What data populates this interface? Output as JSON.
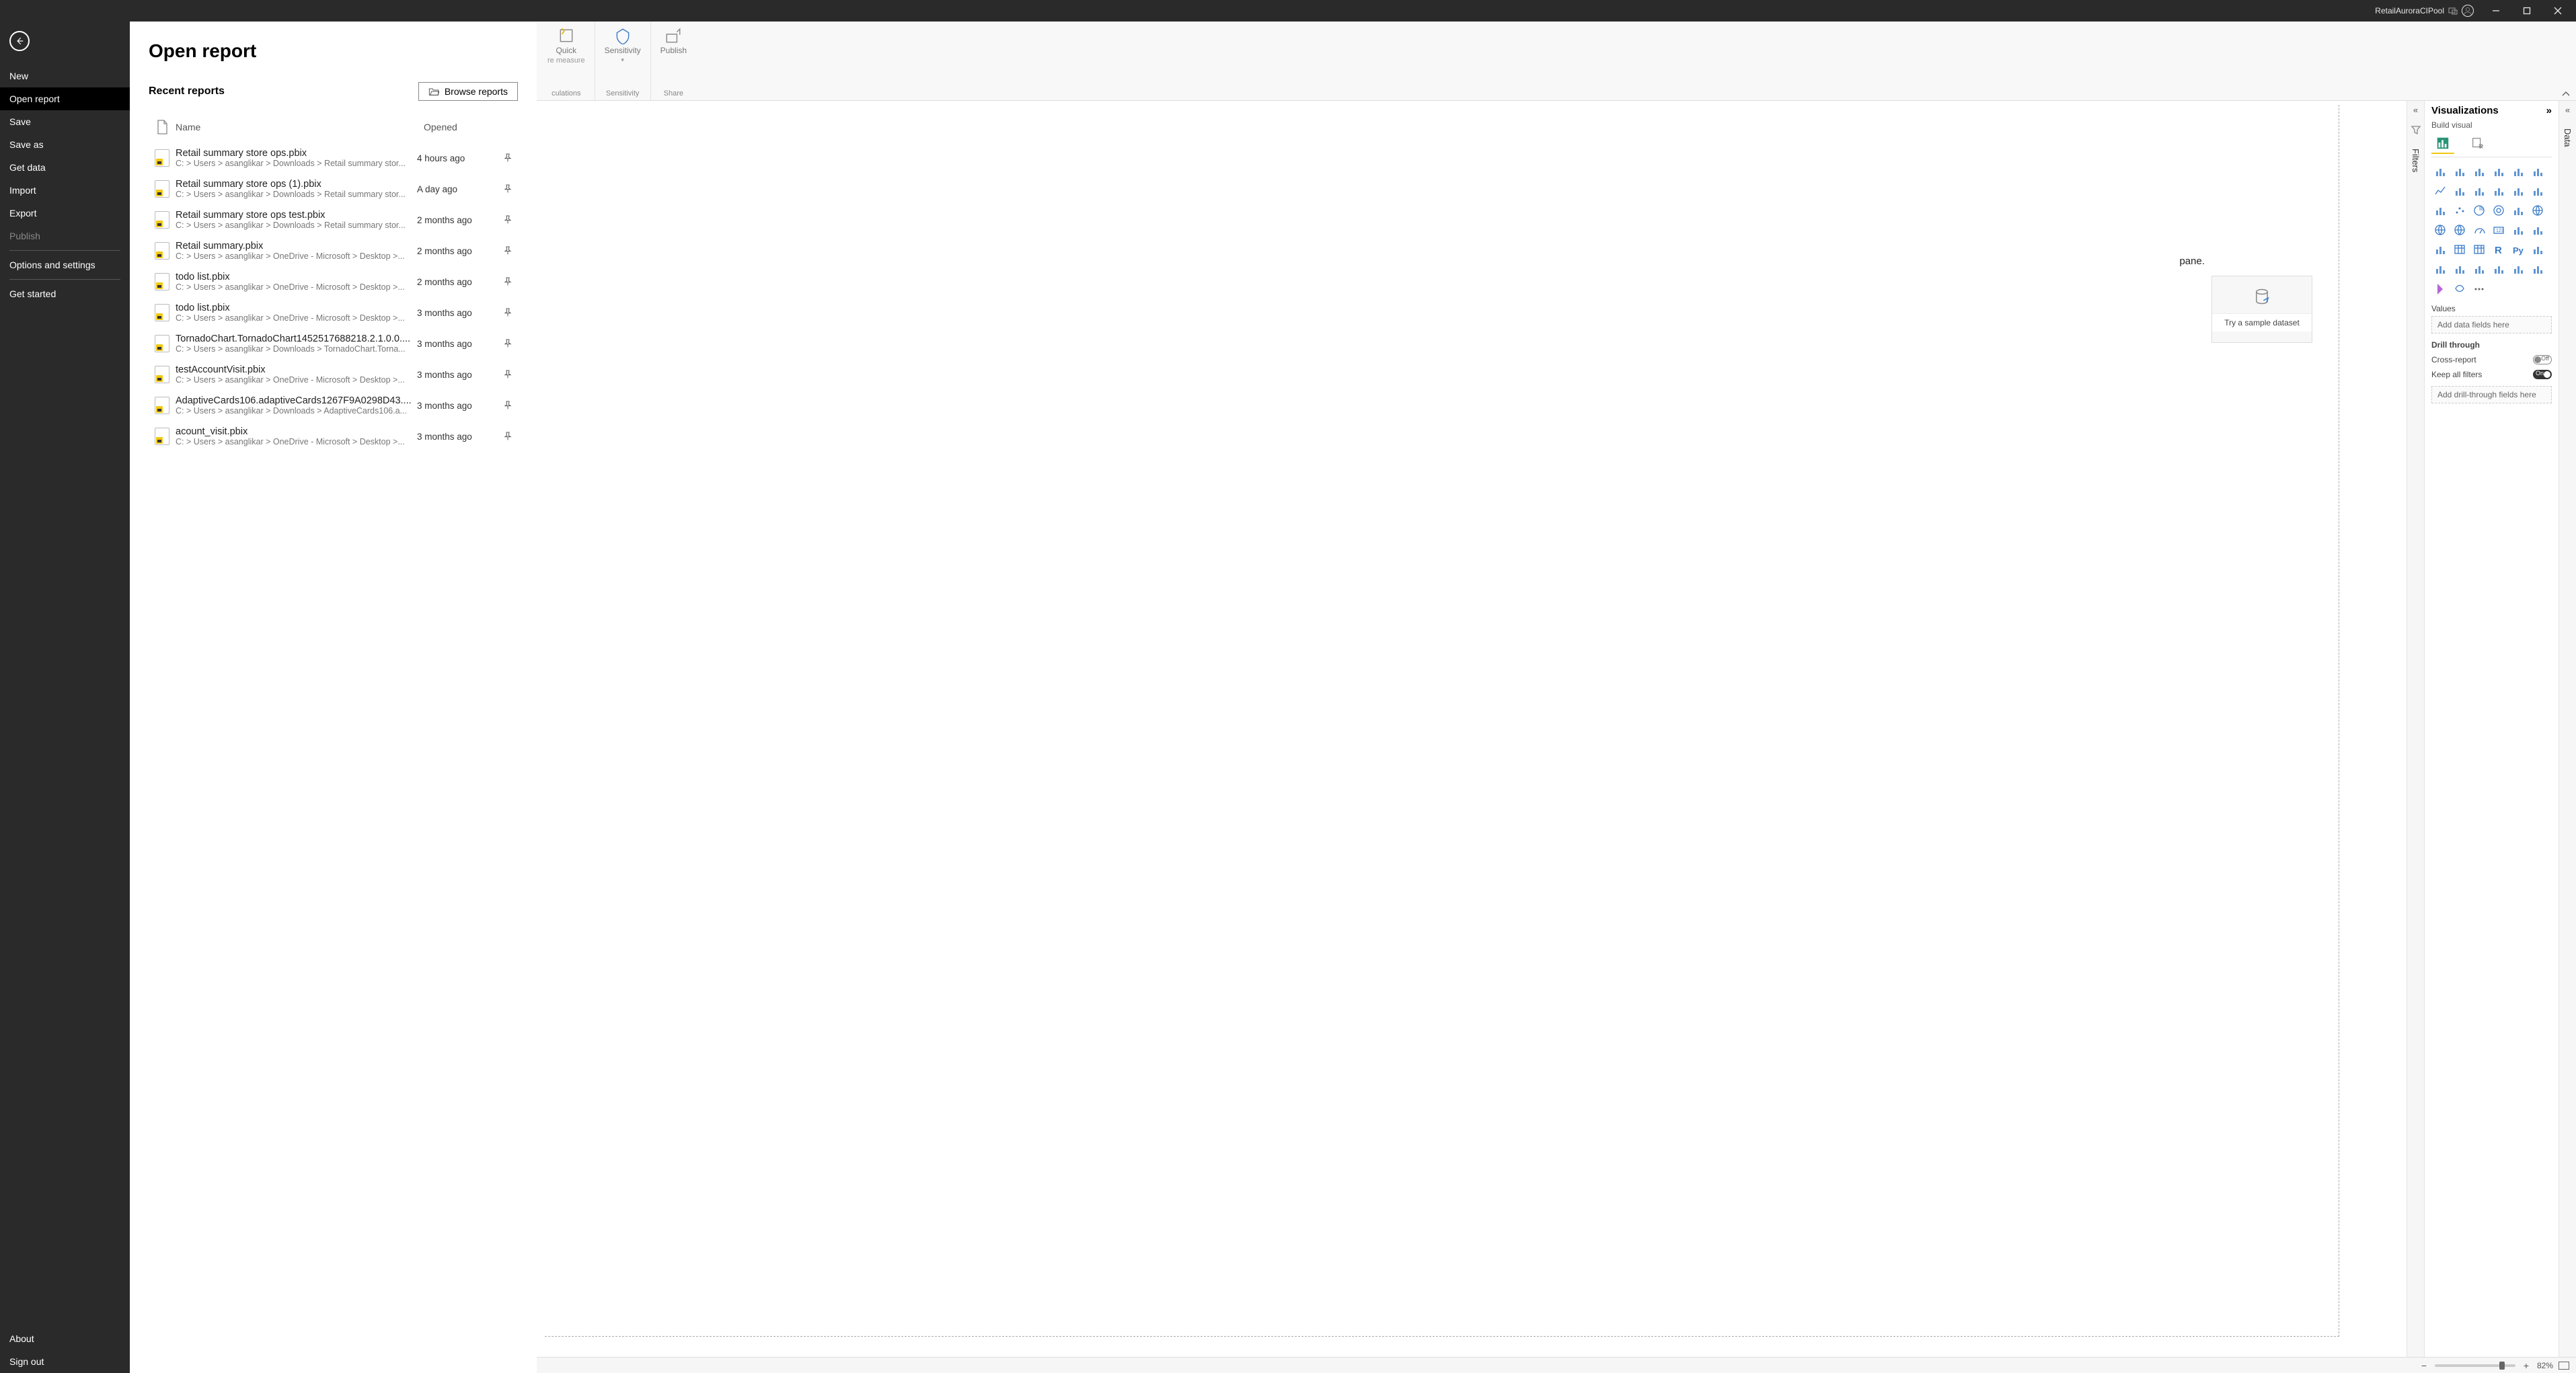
{
  "titlebar": {
    "account": "RetailAuroraCIPool"
  },
  "backstage": {
    "menu": [
      "New",
      "Open report",
      "Save",
      "Save as",
      "Get data",
      "Import",
      "Export",
      "Publish",
      "Options and settings",
      "Get started"
    ],
    "footer": [
      "About",
      "Sign out"
    ],
    "selected": "Open report",
    "disabled": [
      "Publish"
    ],
    "title": "Open report",
    "recent_title": "Recent reports",
    "browse_label": "Browse reports",
    "col_name": "Name",
    "col_opened": "Opened",
    "reports": [
      {
        "name": "Retail summary store ops.pbix",
        "path": "C: > Users > asanglikar > Downloads > Retail summary stor...",
        "opened": "4 hours ago"
      },
      {
        "name": "Retail summary store ops (1).pbix",
        "path": "C: > Users > asanglikar > Downloads > Retail summary stor...",
        "opened": "A day ago"
      },
      {
        "name": "Retail summary store ops test.pbix",
        "path": "C: > Users > asanglikar > Downloads > Retail summary stor...",
        "opened": "2 months ago"
      },
      {
        "name": "Retail summary.pbix",
        "path": "C: > Users > asanglikar > OneDrive - Microsoft > Desktop >...",
        "opened": "2 months ago"
      },
      {
        "name": "todo list.pbix",
        "path": "C: > Users > asanglikar > OneDrive - Microsoft > Desktop >...",
        "opened": "2 months ago"
      },
      {
        "name": "todo list.pbix",
        "path": "C: > Users > asanglikar > OneDrive - Microsoft > Desktop >...",
        "opened": "3 months ago"
      },
      {
        "name": "TornadoChart.TornadoChart1452517688218.2.1.0.0....",
        "path": "C: > Users > asanglikar > Downloads > TornadoChart.Torna...",
        "opened": "3 months ago"
      },
      {
        "name": "testAccountVisit.pbix",
        "path": "C: > Users > asanglikar > OneDrive - Microsoft > Desktop >...",
        "opened": "3 months ago"
      },
      {
        "name": "AdaptiveCards106.adaptiveCards1267F9A0298D43....",
        "path": "C: > Users > asanglikar > Downloads > AdaptiveCards106.a...",
        "opened": "3 months ago"
      },
      {
        "name": "acount_visit.pbix",
        "path": "C: > Users > asanglikar > OneDrive - Microsoft > Desktop >...",
        "opened": "3 months ago"
      }
    ]
  },
  "ribbon": {
    "groups": [
      {
        "label": "culations",
        "buttons": [
          {
            "label1": "Quick",
            "label2": "re measure"
          }
        ]
      },
      {
        "label": "Sensitivity",
        "buttons": [
          {
            "label1": "Sensitivity",
            "label2": "▾"
          }
        ]
      },
      {
        "label": "Share",
        "buttons": [
          {
            "label1": "Publish",
            "label2": ""
          }
        ]
      }
    ]
  },
  "canvas": {
    "hint": "pane.",
    "sample_label": "Try a sample dataset"
  },
  "rails": {
    "filters": "Filters",
    "data": "Data"
  },
  "viz": {
    "title": "Visualizations",
    "subtitle": "Build visual",
    "values_label": "Values",
    "values_placeholder": "Add data fields here",
    "drill_label": "Drill through",
    "cross_report": "Cross-report",
    "cross_report_state": "Off",
    "keep_filters": "Keep all filters",
    "keep_filters_state": "On",
    "drill_placeholder": "Add drill-through fields here"
  },
  "status": {
    "zoom": "82%"
  }
}
